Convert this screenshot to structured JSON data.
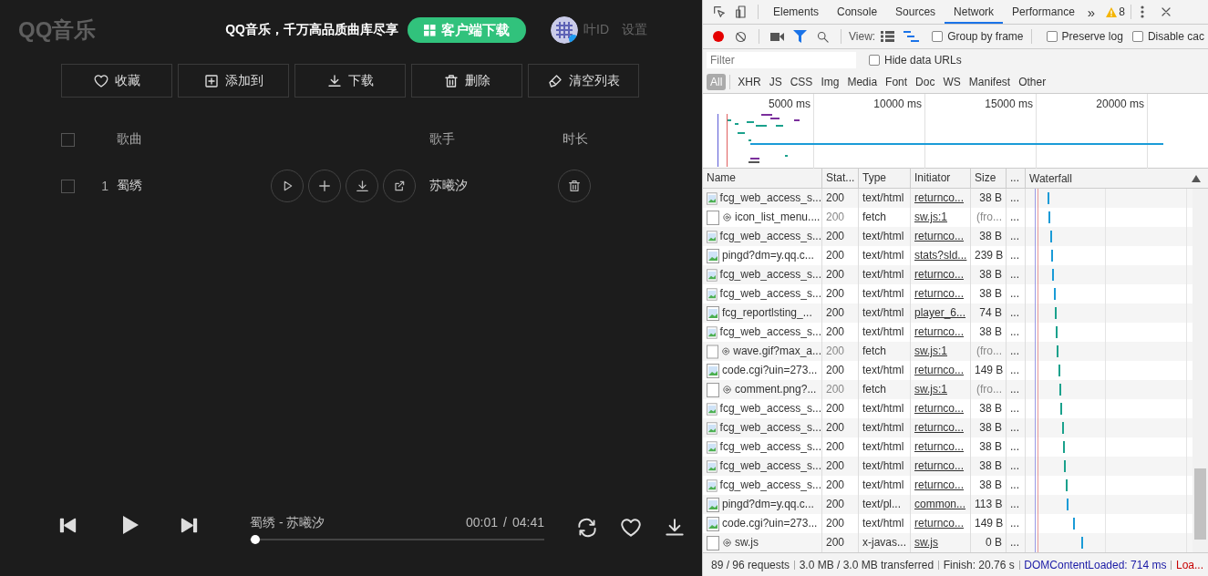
{
  "player_app": {
    "logo": "QQ音乐",
    "promo": "QQ音乐，千万高品质曲库尽享",
    "download_client_button": "客户端下载",
    "user": {
      "name": "叶ID"
    },
    "settings_link": "设置",
    "toolbar": [
      {
        "label": "收藏",
        "kind": "heart"
      },
      {
        "label": "添加到",
        "kind": "add"
      },
      {
        "label": "下载",
        "kind": "download"
      },
      {
        "label": "删除",
        "kind": "delete"
      },
      {
        "label": "清空列表",
        "kind": "clear"
      }
    ],
    "song_table": {
      "columns": [
        "歌曲",
        "歌手",
        "时长"
      ],
      "all_checked": false,
      "rows": [
        {
          "index": "1",
          "title": "蜀绣",
          "artist": "苏曦汐",
          "checked": false
        }
      ]
    },
    "now_playing": {
      "title": "蜀绣 - 苏曦汐",
      "elapsed": "00:01",
      "separator": "/",
      "duration": "04:41",
      "level": 0.003
    }
  },
  "devtools": {
    "tabs": [
      {
        "label": "Elements",
        "selected": false
      },
      {
        "label": "Console",
        "selected": false
      },
      {
        "label": "Sources",
        "selected": false
      },
      {
        "label": "Network",
        "selected": true
      },
      {
        "label": "Performance",
        "selected": false
      }
    ],
    "more_tabs": "»",
    "warning_count": "8",
    "toolbar": {
      "recording": true,
      "view_label": "View:",
      "options": [
        {
          "label": "Group by frame",
          "checked": false
        },
        {
          "label": "Preserve log",
          "checked": false
        },
        {
          "label": "Disable cac",
          "checked": false
        }
      ]
    },
    "filter": {
      "placeholder": "Filter"
    },
    "hide_data_urls": {
      "label": "Hide data URLs",
      "checked": false
    },
    "type_filters": [
      {
        "label": "All",
        "selected": true
      },
      {
        "label": "XHR",
        "selected": false
      },
      {
        "label": "JS",
        "selected": false
      },
      {
        "label": "CSS",
        "selected": false
      },
      {
        "label": "Img",
        "selected": false
      },
      {
        "label": "Media",
        "selected": false
      },
      {
        "label": "Font",
        "selected": false
      },
      {
        "label": "Doc",
        "selected": false
      },
      {
        "label": "WS",
        "selected": false
      },
      {
        "label": "Manifest",
        "selected": false
      },
      {
        "label": "Other",
        "selected": false
      }
    ],
    "overview_ticks": [
      "5000 ms",
      "10000 ms",
      "15000 ms",
      "20000 ms"
    ],
    "requests": {
      "columns": [
        "Name",
        "Stat...",
        "Type",
        "Initiator",
        "Size",
        "...",
        "Waterfall"
      ],
      "rows": [
        {
          "kind": "image",
          "name": "fcg_web_access_s...",
          "status": "200",
          "type": "text/html",
          "initiator": "returnco...",
          "size": "38 B",
          "more": "..."
        },
        {
          "kind": "fetch",
          "name": "icon_list_menu....",
          "status": "200",
          "type": "fetch",
          "initiator": "sw.js:1",
          "size": "(fro...",
          "more": "..."
        },
        {
          "kind": "image",
          "name": "fcg_web_access_s...",
          "status": "200",
          "type": "text/html",
          "initiator": "returnco...",
          "size": "38 B",
          "more": "..."
        },
        {
          "kind": "image",
          "name": "pingd?dm=y.qq.c...",
          "status": "200",
          "type": "text/html",
          "initiator": "stats?sld...",
          "size": "239 B",
          "more": "..."
        },
        {
          "kind": "image",
          "name": "fcg_web_access_s...",
          "status": "200",
          "type": "text/html",
          "initiator": "returnco...",
          "size": "38 B",
          "more": "..."
        },
        {
          "kind": "image",
          "name": "fcg_web_access_s...",
          "status": "200",
          "type": "text/html",
          "initiator": "returnco...",
          "size": "38 B",
          "more": "..."
        },
        {
          "kind": "image",
          "name": "fcg_reportlsting_...",
          "status": "200",
          "type": "text/html",
          "initiator": "player_6...",
          "size": "74 B",
          "more": "..."
        },
        {
          "kind": "image",
          "name": "fcg_web_access_s...",
          "status": "200",
          "type": "text/html",
          "initiator": "returnco...",
          "size": "38 B",
          "more": "..."
        },
        {
          "kind": "fetch",
          "name": "wave.gif?max_a...",
          "status": "200",
          "type": "fetch",
          "initiator": "sw.js:1",
          "size": "(fro...",
          "more": "..."
        },
        {
          "kind": "image",
          "name": "code.cgi?uin=273...",
          "status": "200",
          "type": "text/html",
          "initiator": "returnco...",
          "size": "149 B",
          "more": "..."
        },
        {
          "kind": "fetch",
          "name": "comment.png?...",
          "status": "200",
          "type": "fetch",
          "initiator": "sw.js:1",
          "size": "(fro...",
          "more": "..."
        },
        {
          "kind": "image",
          "name": "fcg_web_access_s...",
          "status": "200",
          "type": "text/html",
          "initiator": "returnco...",
          "size": "38 B",
          "more": "..."
        },
        {
          "kind": "image",
          "name": "fcg_web_access_s...",
          "status": "200",
          "type": "text/html",
          "initiator": "returnco...",
          "size": "38 B",
          "more": "..."
        },
        {
          "kind": "image",
          "name": "fcg_web_access_s...",
          "status": "200",
          "type": "text/html",
          "initiator": "returnco...",
          "size": "38 B",
          "more": "..."
        },
        {
          "kind": "image",
          "name": "fcg_web_access_s...",
          "status": "200",
          "type": "text/html",
          "initiator": "returnco...",
          "size": "38 B",
          "more": "..."
        },
        {
          "kind": "image",
          "name": "fcg_web_access_s...",
          "status": "200",
          "type": "text/html",
          "initiator": "returnco...",
          "size": "38 B",
          "more": "..."
        },
        {
          "kind": "image",
          "name": "pingd?dm=y.qq.c...",
          "status": "200",
          "type": "text/pl...",
          "initiator": "common...",
          "size": "113 B",
          "more": "..."
        },
        {
          "kind": "image",
          "name": "code.cgi?uin=273...",
          "status": "200",
          "type": "text/html",
          "initiator": "returnco...",
          "size": "149 B",
          "more": "..."
        },
        {
          "kind": "script",
          "name": "sw.js",
          "status": "200",
          "type": "x-javas...",
          "initiator": "sw.js",
          "size": "0 B",
          "more": "..."
        }
      ]
    },
    "status_bar": [
      {
        "text": "89 / 96 requests",
        "color": "#333333"
      },
      {
        "text": "3.0 MB / 3.0 MB transferred",
        "color": "#333333"
      },
      {
        "text": "Finish: 20.76 s",
        "color": "#333333"
      },
      {
        "text": "DOMContentLoaded: 714 ms",
        "color": "#1a1aa6"
      },
      {
        "text": "Loa...",
        "color": "#c80000"
      }
    ]
  }
}
